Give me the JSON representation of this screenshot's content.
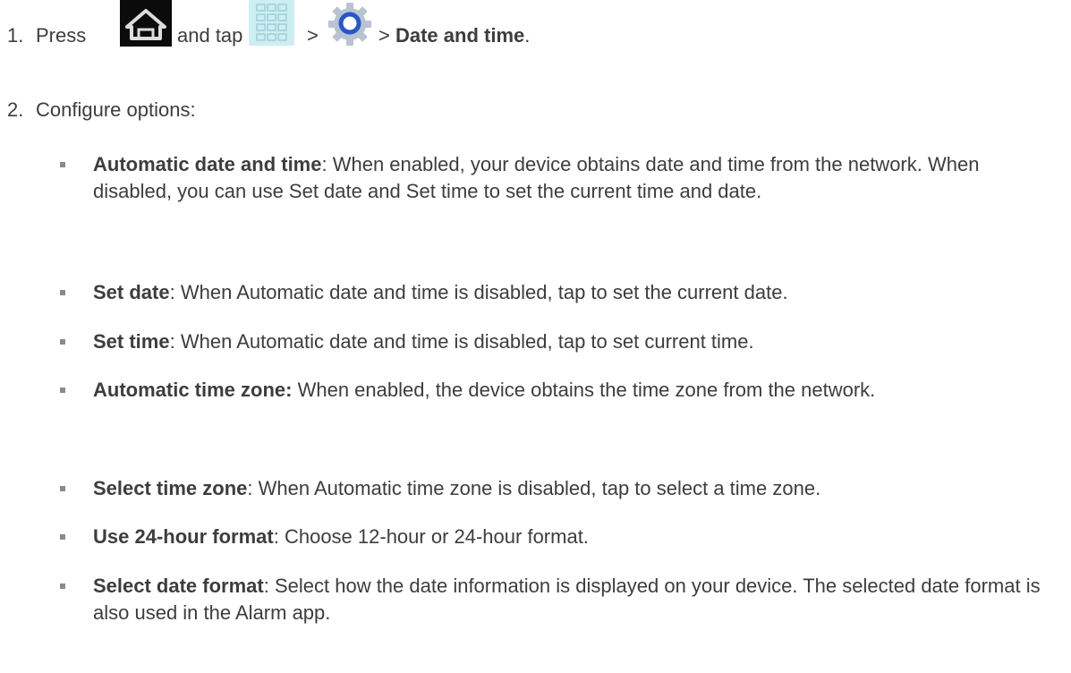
{
  "steps": [
    {
      "number": "1.",
      "parts": {
        "press": "Press",
        "and_tap": "and tap",
        "sep1": ">",
        "sep2": ">",
        "target": "Date and time",
        "end": "."
      },
      "icons": [
        "home-icon",
        "apps-grid-icon",
        "settings-gear-icon"
      ]
    },
    {
      "number": "2.",
      "text": "Configure options:"
    }
  ],
  "options": [
    {
      "term": "Automatic date and time",
      "separator": ":",
      "description": " When enabled, your device obtains date and time from the network. When disabled, you can use Set date and Set time to set the current time and date."
    },
    {
      "term": "Set date",
      "separator": ":",
      "description": " When Automatic date and time is disabled, tap to set the current date."
    },
    {
      "term": "Set time",
      "separator": ":",
      "description": " When Automatic date and time is disabled, tap to set current time."
    },
    {
      "term": "Automatic time zone:",
      "separator": "",
      "description": " When enabled, the device obtains the time zone from the network."
    },
    {
      "term": "Select time zone",
      "separator": ":",
      "description": " When Automatic time zone is disabled, tap to select a time zone."
    },
    {
      "term": "Use 24-hour format",
      "separator": ":",
      "description": " Choose 12-hour or 24-hour format."
    },
    {
      "term": "Select date format",
      "separator": ":",
      "description": " Select how the date information is displayed on your device. The selected date format is also used in the Alarm app."
    }
  ],
  "colors": {
    "text": "#3d3d3d",
    "bullet": "#8a8a8a",
    "home_icon_bg": "#0b0b0b",
    "grid_icon_bg": "#cdeef2",
    "gear_ring": "#2a57c8"
  }
}
